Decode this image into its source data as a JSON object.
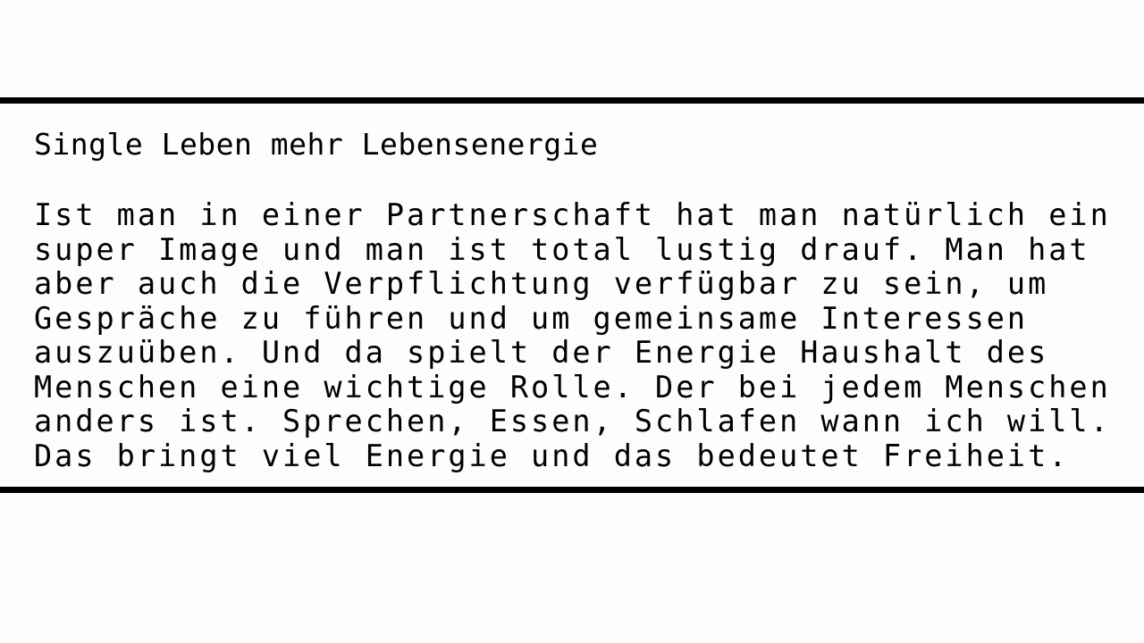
{
  "title": "Single Leben mehr Lebensenergie",
  "paragraph_lines": [
    "Ist man in einer Partnerschaft hat man natürlich ein",
    "super Image und man ist total lustig drauf. Man hat",
    "aber auch die Verpflichtung verfügbar zu sein, um",
    "Gespräche zu führen und um gemeinsame Interessen",
    "auszuüben. Und da spielt der Energie Haushalt des",
    "Menschen eine wichtige Rolle. Der bei jedem Menschen",
    "anders ist. Sprechen, Essen, Schlafen wann ich will.",
    "Das bringt viel Energie und das bedeutet Freiheit."
  ]
}
